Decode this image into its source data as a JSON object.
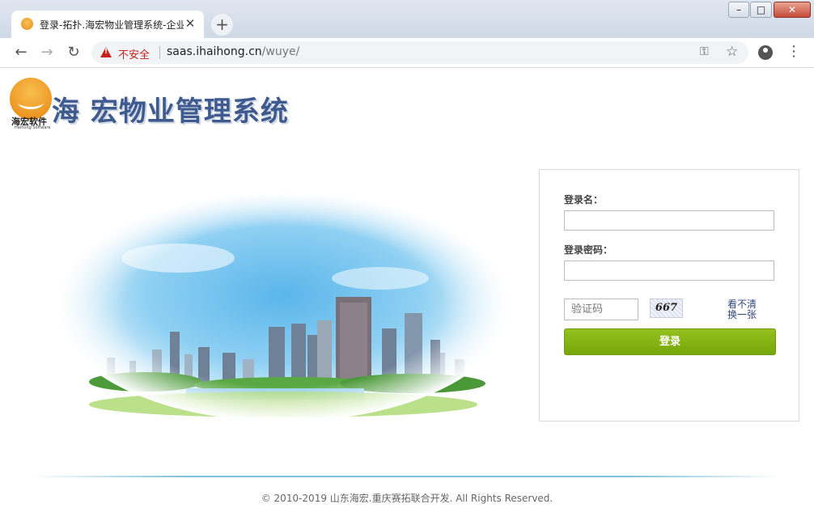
{
  "browser": {
    "tab_title": "登录-拓扑.海宏物业管理系统-企业",
    "tab_close": "✕",
    "new_tab": "+",
    "insecure_label": "不安全",
    "url_host": "saas.ihaihong.cn",
    "url_path": "/wuye/",
    "window_controls": {
      "minimize": "–",
      "maximize": "□",
      "close": "✕"
    }
  },
  "page": {
    "logo_caption": "海宏软件",
    "logo_caption_sub": "Haihong Software",
    "system_title": "海 宏物业管理系统"
  },
  "login": {
    "username_label": "登录名：",
    "password_label": "登录密码：",
    "captcha_placeholder": "验证码",
    "captcha_code": "667",
    "captcha_refresh_line1": "看不清",
    "captcha_refresh_line2": "换一张",
    "submit_label": "登录",
    "accent_color": "#8ab516"
  },
  "footer": {
    "copyright": "© 2010-2019 山东海宏.重庆赛拓联合开发.  All Rights Reserved."
  }
}
